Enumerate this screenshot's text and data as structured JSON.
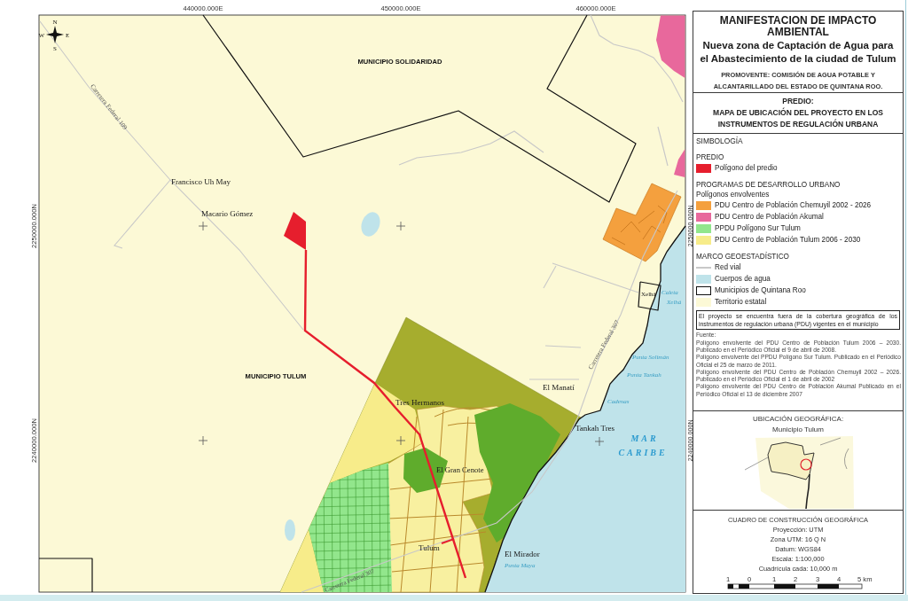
{
  "map": {
    "axis_labels": {
      "top": [
        "440000.000E",
        "450000.000E",
        "460000.000E"
      ],
      "left": [
        "2250000.000N",
        "2240000.000N"
      ],
      "right": [
        "2250000.000N",
        "2240000.000N"
      ]
    },
    "compass": [
      "N",
      "E",
      "S",
      "W"
    ],
    "labels": [
      {
        "text": "MUNICIPIO SOLIDARIDAD",
        "kind": "municipality"
      },
      {
        "text": "Carretera Federal 109",
        "kind": "road"
      },
      {
        "text": "Francisco Uh May",
        "kind": "locality"
      },
      {
        "text": "Macario Gómez",
        "kind": "locality"
      },
      {
        "text": "Xelhá",
        "kind": "locality"
      },
      {
        "text": "Caleta",
        "kind": "water"
      },
      {
        "text": "Xelhá",
        "kind": "water"
      },
      {
        "text": "Punta Solimán",
        "kind": "water"
      },
      {
        "text": "Punta Tankah",
        "kind": "water"
      },
      {
        "text": "Carretera Federal 307",
        "kind": "road"
      },
      {
        "text": "MUNICIPIO TULUM",
        "kind": "municipality"
      },
      {
        "text": "El Manatí",
        "kind": "locality"
      },
      {
        "text": "Cadenas",
        "kind": "water"
      },
      {
        "text": "Tres Hermanos",
        "kind": "locality"
      },
      {
        "text": "Tankah Tres",
        "kind": "locality"
      },
      {
        "text": "MAR",
        "kind": "sea"
      },
      {
        "text": "CARIBE",
        "kind": "sea"
      },
      {
        "text": "El Gran Cenote",
        "kind": "locality"
      },
      {
        "text": "Tulum",
        "kind": "locality"
      },
      {
        "text": "El Mirador",
        "kind": "locality"
      },
      {
        "text": "Punta Maya",
        "kind": "water"
      },
      {
        "text": "Carretera Federal 307",
        "kind": "road"
      }
    ]
  },
  "legend": {
    "title": "MANIFESTACION DE IMPACTO AMBIENTAL",
    "subtitle": "Nueva zona de Captación de Agua para el Abastecimiento de la ciudad de Tulum",
    "promovente": "PROMOVENTE: COMISIÓN DE AGUA POTABLE Y ALCANTARILLADO DEL ESTADO DE QUINTANA ROO.",
    "predio_heading": "PREDIO:",
    "map_title": "MAPA DE UBICACIÓN DEL PROYECTO EN LOS INSTRUMENTOS DE REGULACIÓN URBANA",
    "symbology": {
      "heading": "SIMBOLOGÍA",
      "groups": [
        {
          "title": "PREDIO",
          "items": [
            {
              "label": "Polígono del predio",
              "kind": "fill",
              "color": "#e61e2d"
            }
          ]
        },
        {
          "title": "PROGRAMAS DE DESARROLLO URBANO",
          "subtitle": "Polígonos envolventes",
          "items": [
            {
              "label": "PDU Centro de Población Chemuyil 2002 - 2026",
              "kind": "fill",
              "color": "#f4a03e"
            },
            {
              "label": "PDU Centro de Población Akumal",
              "kind": "fill",
              "color": "#e8689c"
            },
            {
              "label": "PPDU Polígono Sur Tulum",
              "kind": "fill",
              "color": "#92e68c"
            },
            {
              "label": "PDU Centro de Población Tulum 2006 - 2030",
              "kind": "fill",
              "color": "#f7ec8a"
            }
          ]
        },
        {
          "title": "MARCO GEOESTADÍSTICO",
          "items": [
            {
              "label": "Red vial",
              "kind": "line",
              "color": "#c8c8c8"
            },
            {
              "label": "Cuerpos de agua",
              "kind": "fill",
              "color": "#bfe3ea"
            },
            {
              "label": "Municipios de Quintana Roo",
              "kind": "outline",
              "color": "#111111"
            },
            {
              "label": "Territorio estatal",
              "kind": "fill",
              "color": "#fcf9d6"
            }
          ]
        }
      ]
    },
    "notice": "El proyecto se encuentra fuera de la cobertura geográfica de los instrumentos de regulación urbana (PDU) vigentes en el municipio",
    "sources": {
      "heading": "Fuente:",
      "entries": [
        "Polígono envolvente del PDU Centro de Población Tulum 2006 – 2030. Publicado en el Periódico Oficial el 9 de abril de 2008.",
        "Polígono envolvente del PPDU Polígono Sur Tulum. Publicado en el Periódico Oficial el 25 de marzo de 2011.",
        "Polígono envolvente del PDU Centro de Población Chemuyil 2002 – 2026. Publicado en el Periódico Oficial el 1 de abril de 2002",
        "Polígono envolvente del PDU Centro de Población Akumal Publicado en el Periódico Oficial el 13 de diciembre 2007"
      ]
    },
    "location": {
      "heading": "UBICACIÓN GEOGRÁFICA:",
      "subtitle": "Municipio Tulum"
    },
    "construction": {
      "heading": "CUADRO DE CONSTRUCCIÓN GEOGRÁFICA",
      "lines": [
        "Proyección: UTM",
        "Zona UTM: 16 Q N",
        "Datum: WGS84",
        "Escala: 1:100,000",
        "Cuadrícula cada: 10,000 m"
      ],
      "scale_labels": [
        "1",
        "0",
        "1",
        "2",
        "3",
        "4",
        "5 km"
      ]
    }
  }
}
